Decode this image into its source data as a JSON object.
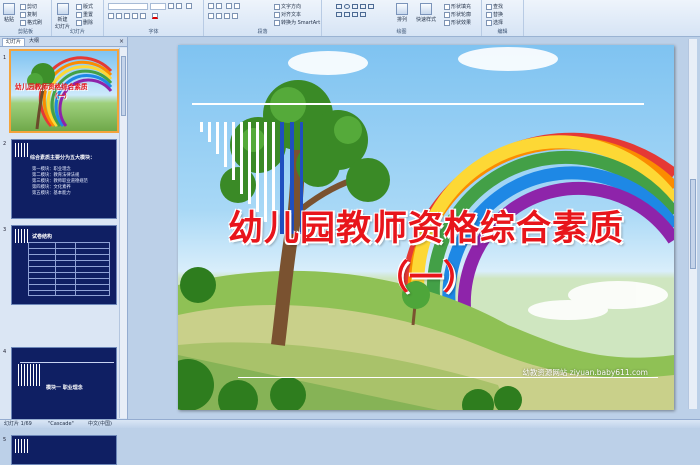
{
  "ribbon": {
    "groups": [
      {
        "label": "剪贴板"
      },
      {
        "label": "幻灯片"
      },
      {
        "label": "字体"
      },
      {
        "label": "段落"
      },
      {
        "label": "绘图"
      },
      {
        "label": "编辑"
      }
    ],
    "clipboard": {
      "paste": "粘贴",
      "cut": "剪切",
      "copy": "复制",
      "format_painter": "格式刷"
    },
    "slides": {
      "new_slide": "新建\n幻灯片",
      "layout": "版式",
      "reset": "重置",
      "delete": "删除"
    },
    "paragraph": {
      "text_direction": "文字方向",
      "align_text": "对齐文本",
      "smartart": "转换为 SmartArt"
    },
    "drawing": {
      "arrange": "排列",
      "quick_styles": "快速样式",
      "shape_fill": "形状填充",
      "shape_outline": "形状轮廓",
      "shape_effects": "形状效果"
    },
    "editing": {
      "find": "查找",
      "replace": "替换",
      "select": "选择"
    }
  },
  "pane": {
    "tabs": [
      {
        "label": "幻灯片"
      },
      {
        "label": "大纲"
      }
    ],
    "close": "×",
    "thumbnails": [
      {
        "num": "1",
        "title_line1": "幼儿园教师资格综合素质",
        "title_line2": "（一）"
      },
      {
        "num": "2",
        "title": "综合素质主要分为五大模块：",
        "lines": [
          "第一模块：职业理念",
          "第二模块：教育法律法规",
          "第三模块：教师职业道德规范",
          "第四模块：文化素养",
          "第五模块：基本能力"
        ]
      },
      {
        "num": "3",
        "title": "试卷结构"
      },
      {
        "num": "4",
        "title": "模块一  职业理念"
      },
      {
        "num": "5"
      }
    ]
  },
  "slide": {
    "title": "幼儿园教师资格综合素质",
    "subtitle": "（一）",
    "website": "幼教资源网站  ziyuan.baby611.com"
  },
  "status": {
    "slide_indicator": "幻灯片 1/69",
    "theme": "\"Cascade\"",
    "language": "中文(中国)"
  },
  "colors": {
    "title_red": "#e8151b",
    "thumb_navy": "#0f1f63",
    "selection_orange": "#f3a33b"
  }
}
